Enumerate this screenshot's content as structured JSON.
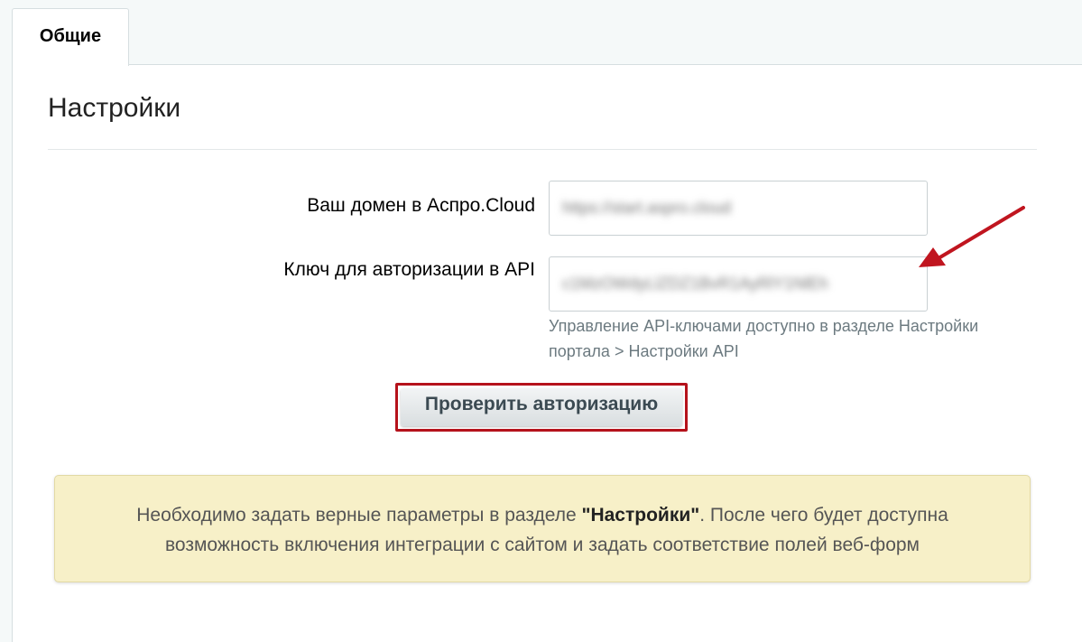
{
  "tabs": [
    {
      "label": "Общие",
      "active": true
    }
  ],
  "section": {
    "title": "Настройки"
  },
  "form": {
    "domain": {
      "label": "Ваш домен в Аспро.Cloud",
      "value": "https://start.aspro.cloud"
    },
    "api_key": {
      "label": "Ключ для авторизации в API",
      "value": "c1MzOWdyLlZDZ1BvR1AyRlY1NlEh",
      "hint": "Управление API-ключами доступно в разделе Настройки портала > Настройки API"
    },
    "check_button": {
      "label": "Проверить авторизацию"
    }
  },
  "notice": {
    "text_before": "Необходимо задать верные параметры в разделе ",
    "emphasis": "\"Настройки\"",
    "text_after": ". После чего будет доступна возможность включения интеграции с сайтом и задать соответствие полей веб-форм"
  },
  "colors": {
    "highlight_frame": "#b5121b",
    "arrow": "#c0151f",
    "notice_bg": "#f7f0c8"
  },
  "icons": {
    "annotation": "red-arrow-icon"
  }
}
